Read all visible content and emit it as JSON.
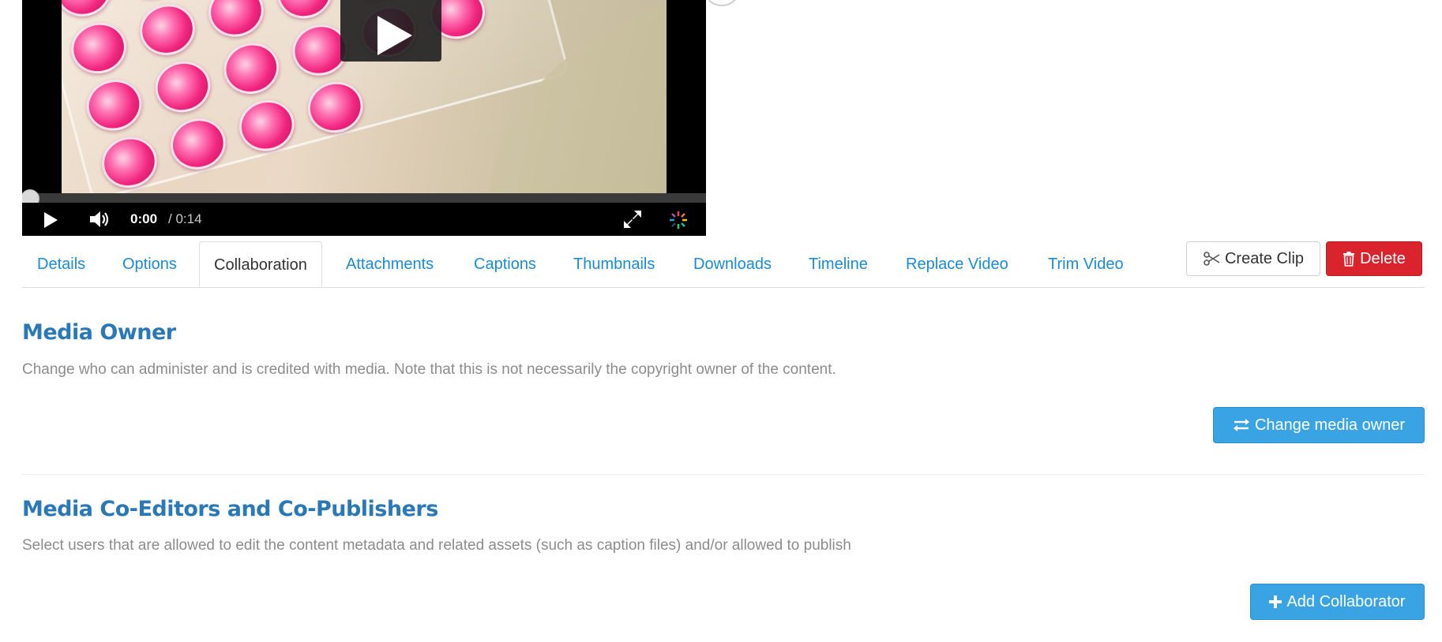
{
  "player": {
    "time_current": "0:00",
    "time_total": "/ 0:14",
    "progress": 0
  },
  "tabs": [
    {
      "label": "Details",
      "active": false
    },
    {
      "label": "Options",
      "active": false
    },
    {
      "label": "Collaboration",
      "active": true
    },
    {
      "label": "Attachments",
      "active": false
    },
    {
      "label": "Captions",
      "active": false
    },
    {
      "label": "Thumbnails",
      "active": false
    },
    {
      "label": "Downloads",
      "active": false
    },
    {
      "label": "Timeline",
      "active": false
    },
    {
      "label": "Replace Video",
      "active": false
    },
    {
      "label": "Trim Video",
      "active": false
    }
  ],
  "actions": {
    "create_clip_label": "Create Clip",
    "create_clip_icon": "scissors-icon",
    "delete_label": "Delete",
    "delete_icon": "trash-icon"
  },
  "owner_section": {
    "title": "Media Owner",
    "description": "Change who can administer and is credited with media. Note that this is not necessarily the copyright owner of the content.",
    "button_label": "Change media owner",
    "button_icon": "exchange-icon"
  },
  "collab_section": {
    "title": "Media Co-Editors and Co-Publishers",
    "description": "Select users that are allowed to edit the content metadata and related assets (such as caption files) and/or allowed to publish",
    "button_label": "Add Collaborator",
    "button_icon": "plus-icon"
  },
  "colors": {
    "link": "#1a8bd6",
    "heading": "#2a78b5",
    "primary_button": "#3aa3e3",
    "danger_button": "#d9232d"
  }
}
